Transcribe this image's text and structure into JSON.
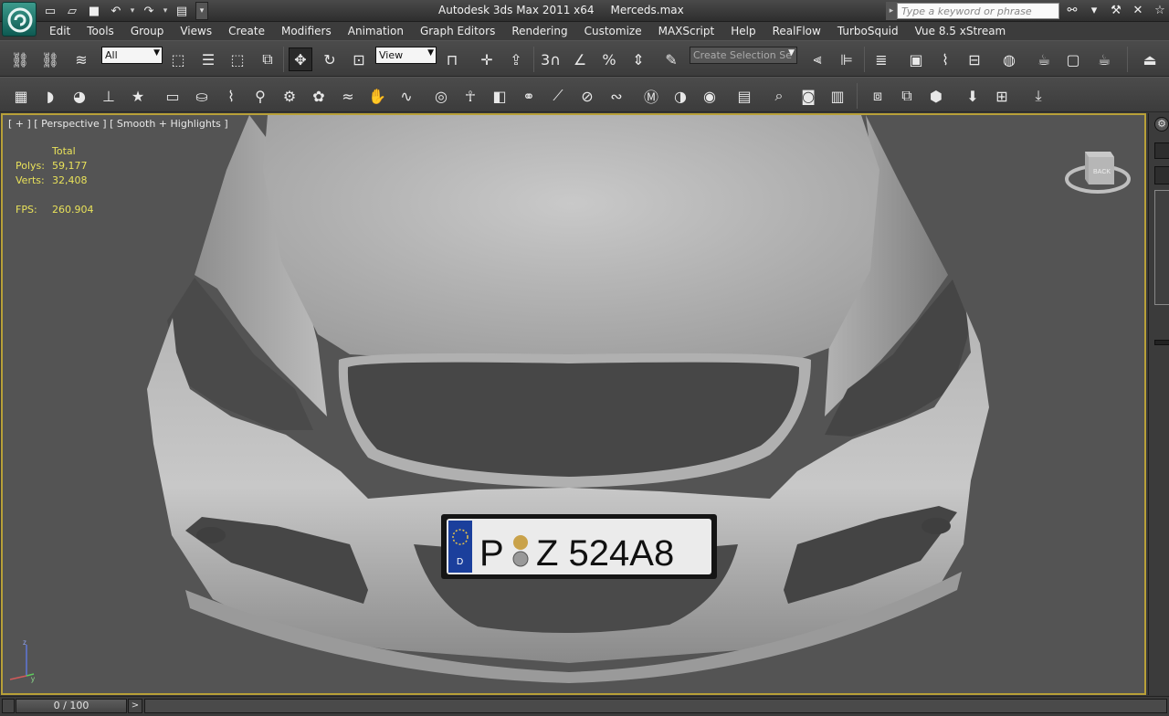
{
  "titlebar": {
    "app_name": "Autodesk 3ds Max  2011 x64",
    "file_name": "Merceds.max",
    "search_placeholder": "Type a keyword or phrase"
  },
  "menu": [
    "Edit",
    "Tools",
    "Group",
    "Views",
    "Create",
    "Modifiers",
    "Animation",
    "Graph Editors",
    "Rendering",
    "Customize",
    "MAXScript",
    "Help",
    "RealFlow",
    "TurboSquid",
    "Vue 8.5 xStream"
  ],
  "toolbar": {
    "selection_filter": "All",
    "reference_coord": "View",
    "snaps_label": "3",
    "selection_set_placeholder": "Create Selection Se"
  },
  "viewport": {
    "label": "[ + ] [ Perspective ] [ Smooth + Highlights ]",
    "stats": {
      "header": "Total",
      "polys_label": "Polys:",
      "polys": "59,177",
      "verts_label": "Verts:",
      "verts": "32,408",
      "fps_label": "FPS:",
      "fps": "260.904"
    },
    "license_plate": {
      "country": "D",
      "text_left": "P",
      "text_right": "Z 524A8"
    },
    "viewcube_face": "BACK",
    "axis_labels": [
      "z",
      "y"
    ]
  },
  "timeline": {
    "frame_display": "0 / 100",
    "next_button": ">"
  },
  "colors": {
    "viewport_border": "#b8a038",
    "stats_text": "#e8e15a",
    "logo": "#1f7a6e"
  }
}
